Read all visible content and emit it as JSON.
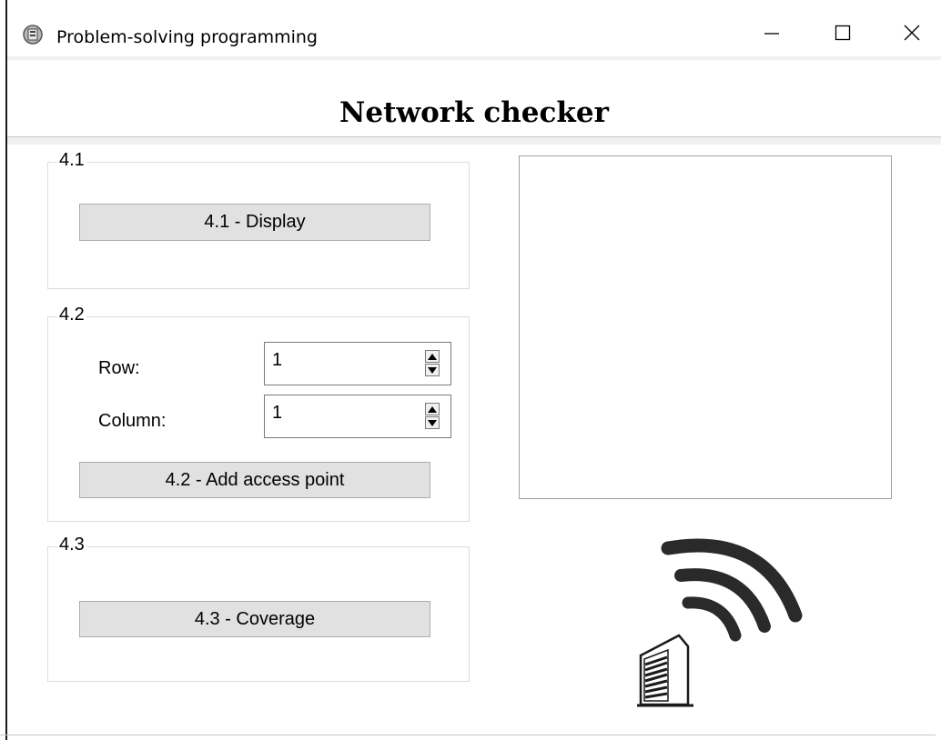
{
  "window": {
    "title": "Problem-solving programming",
    "minimize_glyph": "—",
    "maximize_glyph": "☐",
    "close_glyph": "✕"
  },
  "header": {
    "title": "Network checker"
  },
  "group_41": {
    "legend": "4.1",
    "display_button": "4.1 - Display"
  },
  "group_42": {
    "legend": "4.2",
    "row_label": "Row:",
    "row_value": "1",
    "column_label": "Column:",
    "column_value": "1",
    "add_button": "4.2 - Add access point"
  },
  "group_43": {
    "legend": "4.3",
    "coverage_button": "4.3 - Coverage"
  },
  "icons": {
    "app": "app-icon",
    "wifi": "wifi-signal-icon",
    "building": "building-icon"
  }
}
